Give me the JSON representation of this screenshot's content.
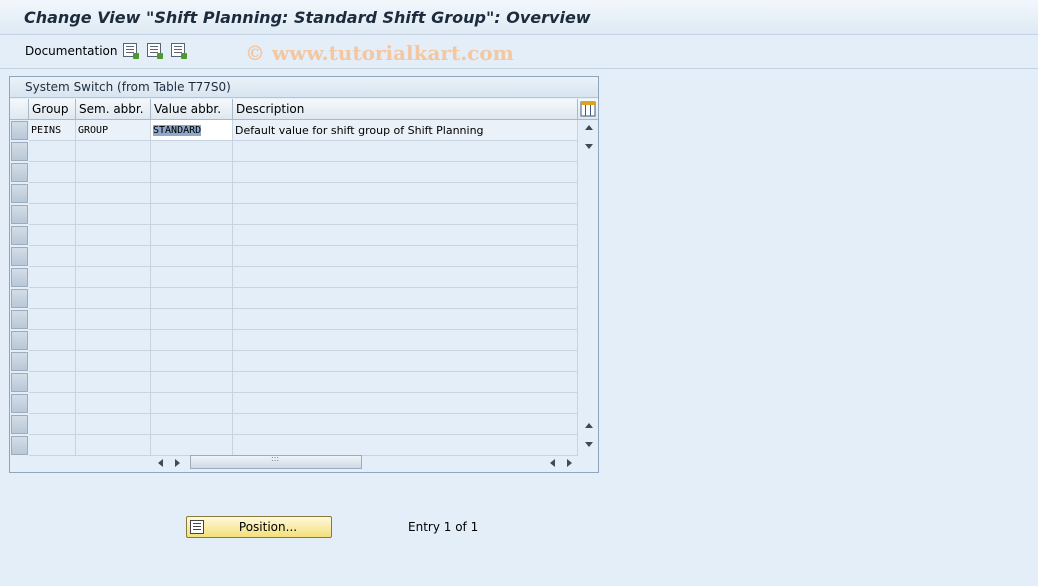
{
  "title": "Change View \"Shift Planning: Standard Shift Group\": Overview",
  "toolbar": {
    "documentation_label": "Documentation",
    "icons": [
      "export-list-icon",
      "import-list-icon",
      "print-list-icon"
    ]
  },
  "watermark": "© www.tutorialkart.com",
  "table": {
    "caption": "System Switch (from Table T77S0)",
    "columns": [
      "Group",
      "Sem. abbr.",
      "Value abbr.",
      "Description"
    ],
    "rows": [
      {
        "group": "PEINS",
        "sem_abbr": "GROUP",
        "value_abbr": "STANDARD",
        "description": "Default value for shift group of Shift Planning"
      }
    ],
    "empty_row_count": 15
  },
  "position_button": {
    "label": "Position..."
  },
  "entry_info": "Entry 1 of 1",
  "colors": {
    "background": "#e4eef8",
    "title_text": "#1d2c3d",
    "button_yellow": "#f4df7a",
    "selection": "#8fa7c9"
  }
}
